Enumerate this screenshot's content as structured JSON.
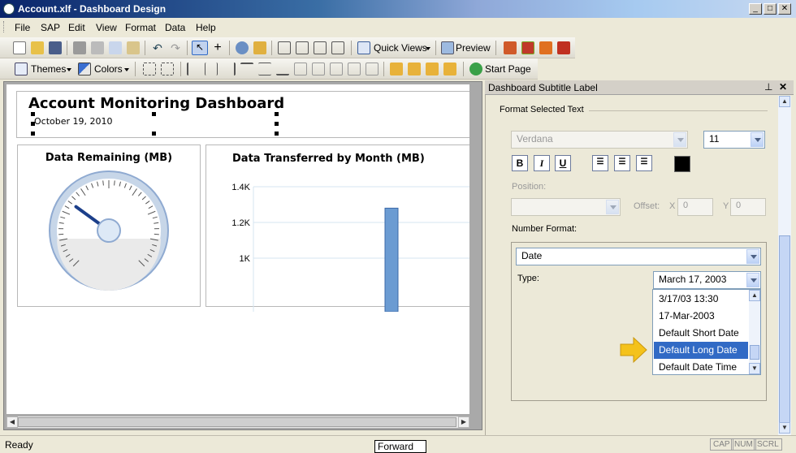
{
  "window": {
    "title": "Account.xlf - Dashboard Design"
  },
  "menu": [
    "File",
    "SAP",
    "Edit",
    "View",
    "Format",
    "Data",
    "Help"
  ],
  "toolbar1": {
    "quick_views": "Quick Views",
    "preview": "Preview"
  },
  "toolbar2": {
    "themes": "Themes",
    "colors": "Colors",
    "start_page": "Start Page"
  },
  "canvas": {
    "title": "Account Monitoring Dashboard",
    "subtitle": "October 19, 2010",
    "gauge_title": "Data Remaining (MB)",
    "gauge_value_fraction": 0.3,
    "chart_title": "Data Transferred by Month (MB)"
  },
  "chart_data": {
    "type": "bar",
    "title": "Data Transferred by Month (MB)",
    "y_ticks": [
      "1.4K",
      "1.2K",
      "1K"
    ],
    "ylim": [
      1000,
      1400
    ],
    "values": [
      1280
    ]
  },
  "panel": {
    "title": "Dashboard Subtitle Label",
    "section_label": "Format Selected Text",
    "font_name": "Verdana",
    "font_size": "11",
    "bold": "B",
    "italic": "I",
    "underline": "U",
    "position_label": "Position:",
    "offset_label": "Offset:",
    "x_label": "X",
    "y_label": "Y",
    "x_value": "0",
    "y_value": "0",
    "number_format_label": "Number Format:",
    "number_format_value": "Date",
    "type_label": "Type:",
    "type_value": "March 17, 2003",
    "type_options": [
      "3/17/03 13:30",
      "17-Mar-2003",
      "Default Short Date",
      "Default Long Date",
      "Default Date Time"
    ],
    "selected_option": "Default Long Date",
    "text_color": "#000000"
  },
  "status": {
    "text": "Ready",
    "tooltip": "Forward",
    "cap": "CAP",
    "num": "NUM",
    "scrl": "SCRL"
  }
}
